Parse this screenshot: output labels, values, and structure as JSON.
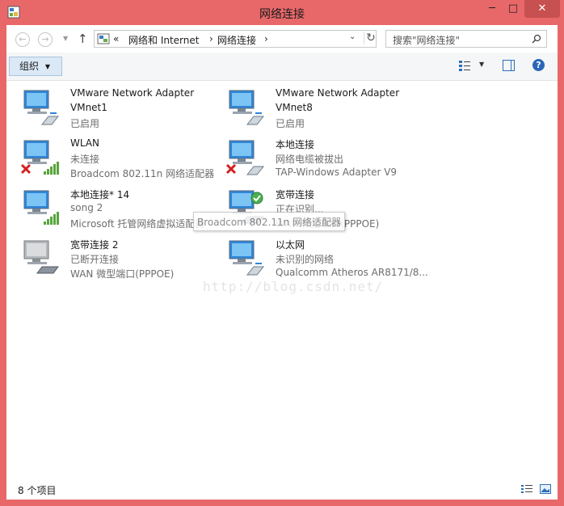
{
  "window": {
    "title": "网络连接",
    "minimize": "─",
    "maximize": "□",
    "close": "✕"
  },
  "nav": {
    "back": "←",
    "forward": "→",
    "recent": "▼",
    "up": "↑",
    "breadcrumb_sep0": "«",
    "breadcrumb": [
      "网络和 Internet",
      "网络连接"
    ],
    "sep": "›",
    "dropdown": "⌄",
    "refresh": "↻",
    "search_placeholder": "搜索\"网络连接\""
  },
  "toolbar": {
    "organize": "组织",
    "organize_arrow": "▼",
    "view_drop": "▼",
    "help": "?"
  },
  "connections": [
    {
      "name": "VMware Network Adapter VMnet1",
      "name_line1": "VMware Network Adapter",
      "name_line2": "VMnet1",
      "status": "已启用",
      "device": "",
      "type": "ethernet",
      "state": "enabled"
    },
    {
      "name": "VMware Network Adapter VMnet8",
      "name_line1": "VMware Network Adapter",
      "name_line2": "VMnet8",
      "status": "已启用",
      "device": "",
      "type": "ethernet",
      "state": "enabled"
    },
    {
      "name": "WLAN",
      "status": "未连接",
      "device": "Broadcom 802.11n 网络适配器",
      "type": "wireless",
      "state": "disconnected"
    },
    {
      "name": "本地连接",
      "status": "网络电缆被拔出",
      "device": "TAP-Windows Adapter V9",
      "type": "ethernet",
      "state": "unplugged"
    },
    {
      "name": "本地连接* 14",
      "status": "song  2",
      "device": "Microsoft 托管网络虚拟适配器",
      "type": "wireless",
      "state": "connected"
    },
    {
      "name": "宽带连接",
      "status": "正在识别...",
      "device": "WAN 微型端口(PPPOE)",
      "type": "broadband",
      "state": "identifying"
    },
    {
      "name": "宽带连接 2",
      "status": "已断开连接",
      "device": "WAN 微型端口(PPPOE)",
      "type": "broadband",
      "state": "disconnected"
    },
    {
      "name": "以太网",
      "status": "未识别的网络",
      "device": "Qualcomm Atheros AR8171/8...",
      "type": "ethernet",
      "state": "unidentified"
    }
  ],
  "tooltip": {
    "text": "Broadcom 802.11n 网络适配器"
  },
  "watermark": "http://blog.csdn.net/",
  "status": {
    "item_count": "8 个项目"
  },
  "colors": {
    "frame": "#e8686a",
    "close": "#c75050",
    "accent": "#2a66b9"
  }
}
